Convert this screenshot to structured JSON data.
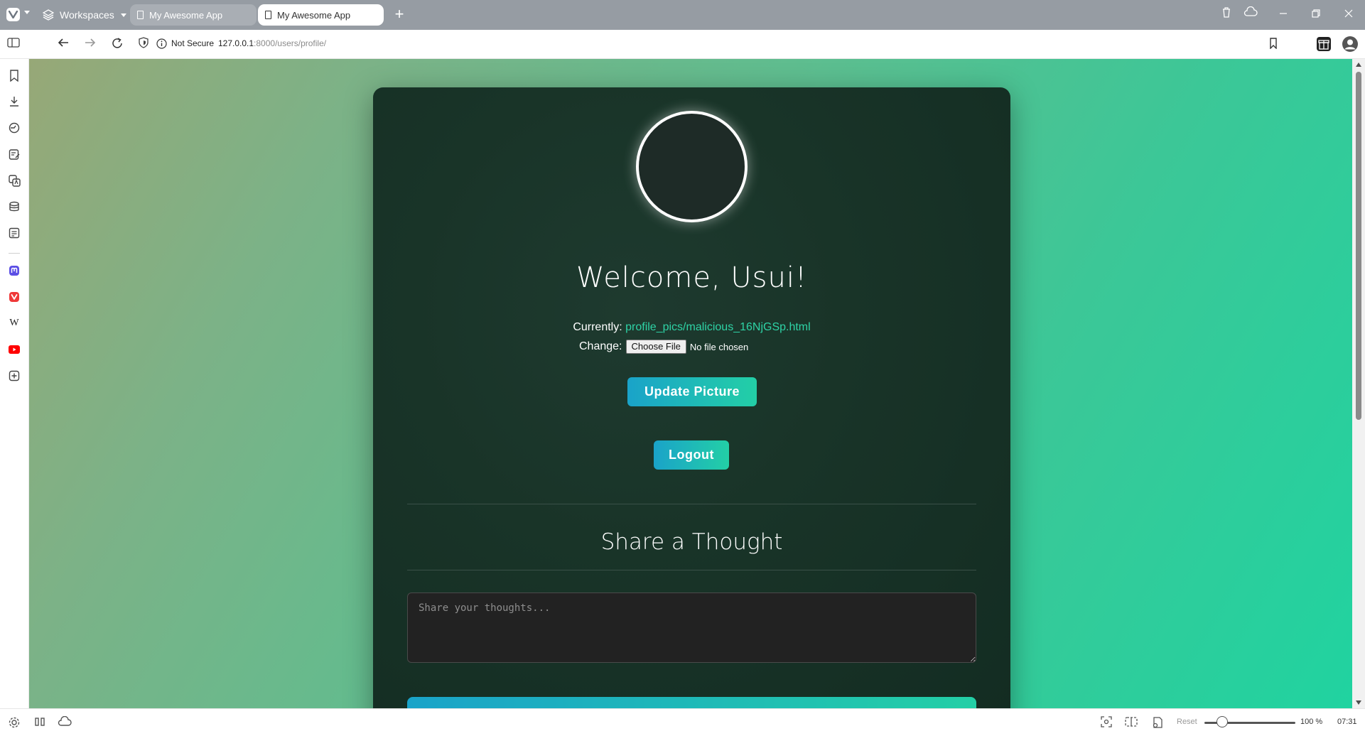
{
  "browser": {
    "workspaces_label": "Workspaces",
    "tabs": [
      {
        "title": "My Awesome App",
        "active": false
      },
      {
        "title": "My Awesome App",
        "active": true
      }
    ],
    "security_label": "Not Secure",
    "url_host": "127.0.0.1",
    "url_path": ":8000/users/profile/",
    "zoom_reset_label": "Reset",
    "zoom_level": "100 %",
    "clock": "07:31"
  },
  "page": {
    "welcome": "Welcome, Usui!",
    "currently_label": "Currently:",
    "current_file": "profile_pics/malicious_16NjGSp.html",
    "change_label": "Change:",
    "choose_file_label": "Choose File",
    "no_file_text": "No file chosen",
    "update_button": "Update Picture",
    "logout_button": "Logout",
    "share_title": "Share a Thought",
    "thought_placeholder": "Share your thoughts..."
  },
  "colors": {
    "accent_start": "#1aa3c9",
    "accent_end": "#23cfa6",
    "link": "#2ed3a6",
    "card_bg": "#193428"
  },
  "icons": {
    "sidebar": [
      "bookmarks-icon",
      "downloads-icon",
      "history-icon",
      "notes-icon",
      "translate-icon",
      "reading-list-icon",
      "calendar-icon",
      "mastodon-icon",
      "vivaldi-icon",
      "wikipedia-icon",
      "youtube-icon",
      "add-panel-icon"
    ]
  }
}
